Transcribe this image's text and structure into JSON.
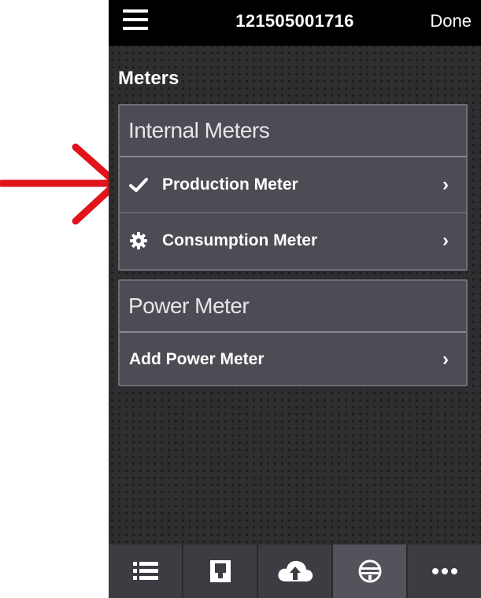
{
  "header": {
    "serial": "121505001716",
    "done_label": "Done"
  },
  "page": {
    "title": "Meters"
  },
  "sections": [
    {
      "title": "Internal Meters",
      "items": [
        {
          "label": "Production Meter",
          "icon": "check-icon"
        },
        {
          "label": "Consumption Meter",
          "icon": "gear-icon"
        }
      ]
    },
    {
      "title": "Power Meter",
      "items": [
        {
          "label": "Add Power Meter",
          "icon": ""
        }
      ]
    }
  ],
  "tabbar": {
    "tabs": [
      {
        "icon": "list-icon"
      },
      {
        "icon": "device-icon"
      },
      {
        "icon": "cloud-upload-icon"
      },
      {
        "icon": "meter-icon",
        "active": true
      },
      {
        "icon": "more-icon"
      }
    ]
  },
  "colors": {
    "annotation_arrow": "#e0141b",
    "header_bg": "#000000",
    "panel_bg": "#4c4d54"
  }
}
